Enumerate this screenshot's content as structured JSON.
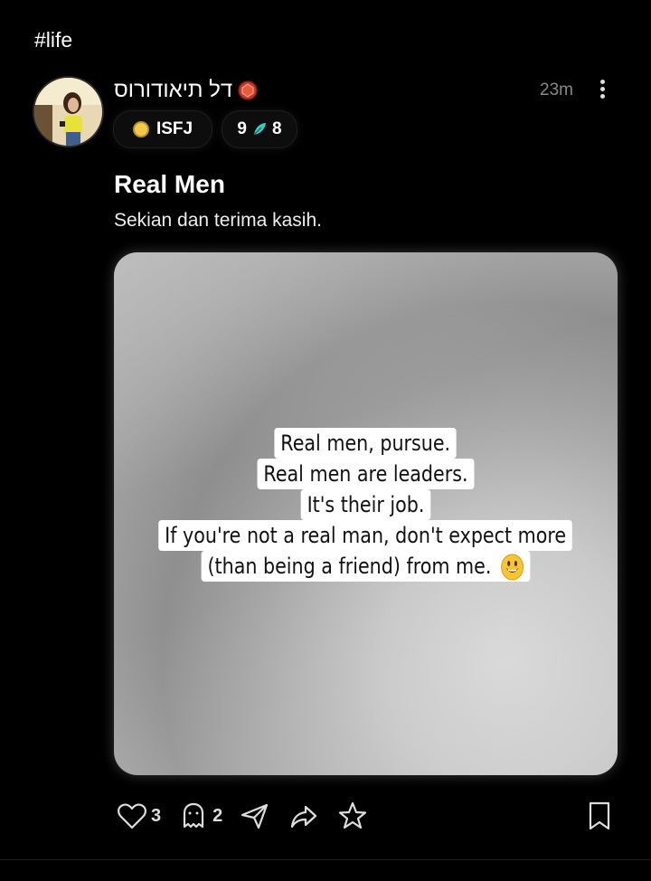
{
  "post": {
    "hashtag": "#life",
    "author": {
      "name": "דל תיאודורוס",
      "avatar": "avatar-photo",
      "badge_icon": "red-gem-icon",
      "mbti": "ISFJ",
      "reputation_left": "9",
      "reputation_right": "8",
      "reputation_icon": "teal-feather-icon"
    },
    "time": "23m",
    "title": "Real Men",
    "subtitle": "Sekian dan terima kasih.",
    "image_quote": [
      "Real men, pursue.",
      "Real men are leaders.",
      "It's their job.",
      "If you're not a real man, don't expect more",
      "(than being a friend) from me."
    ],
    "actions": {
      "like_count": "3",
      "comment_count": "2"
    }
  },
  "colors": {
    "background": "#000000",
    "text": "#ffffff",
    "muted": "#8a8a8a",
    "mbti_dot": "#f2c94c"
  }
}
